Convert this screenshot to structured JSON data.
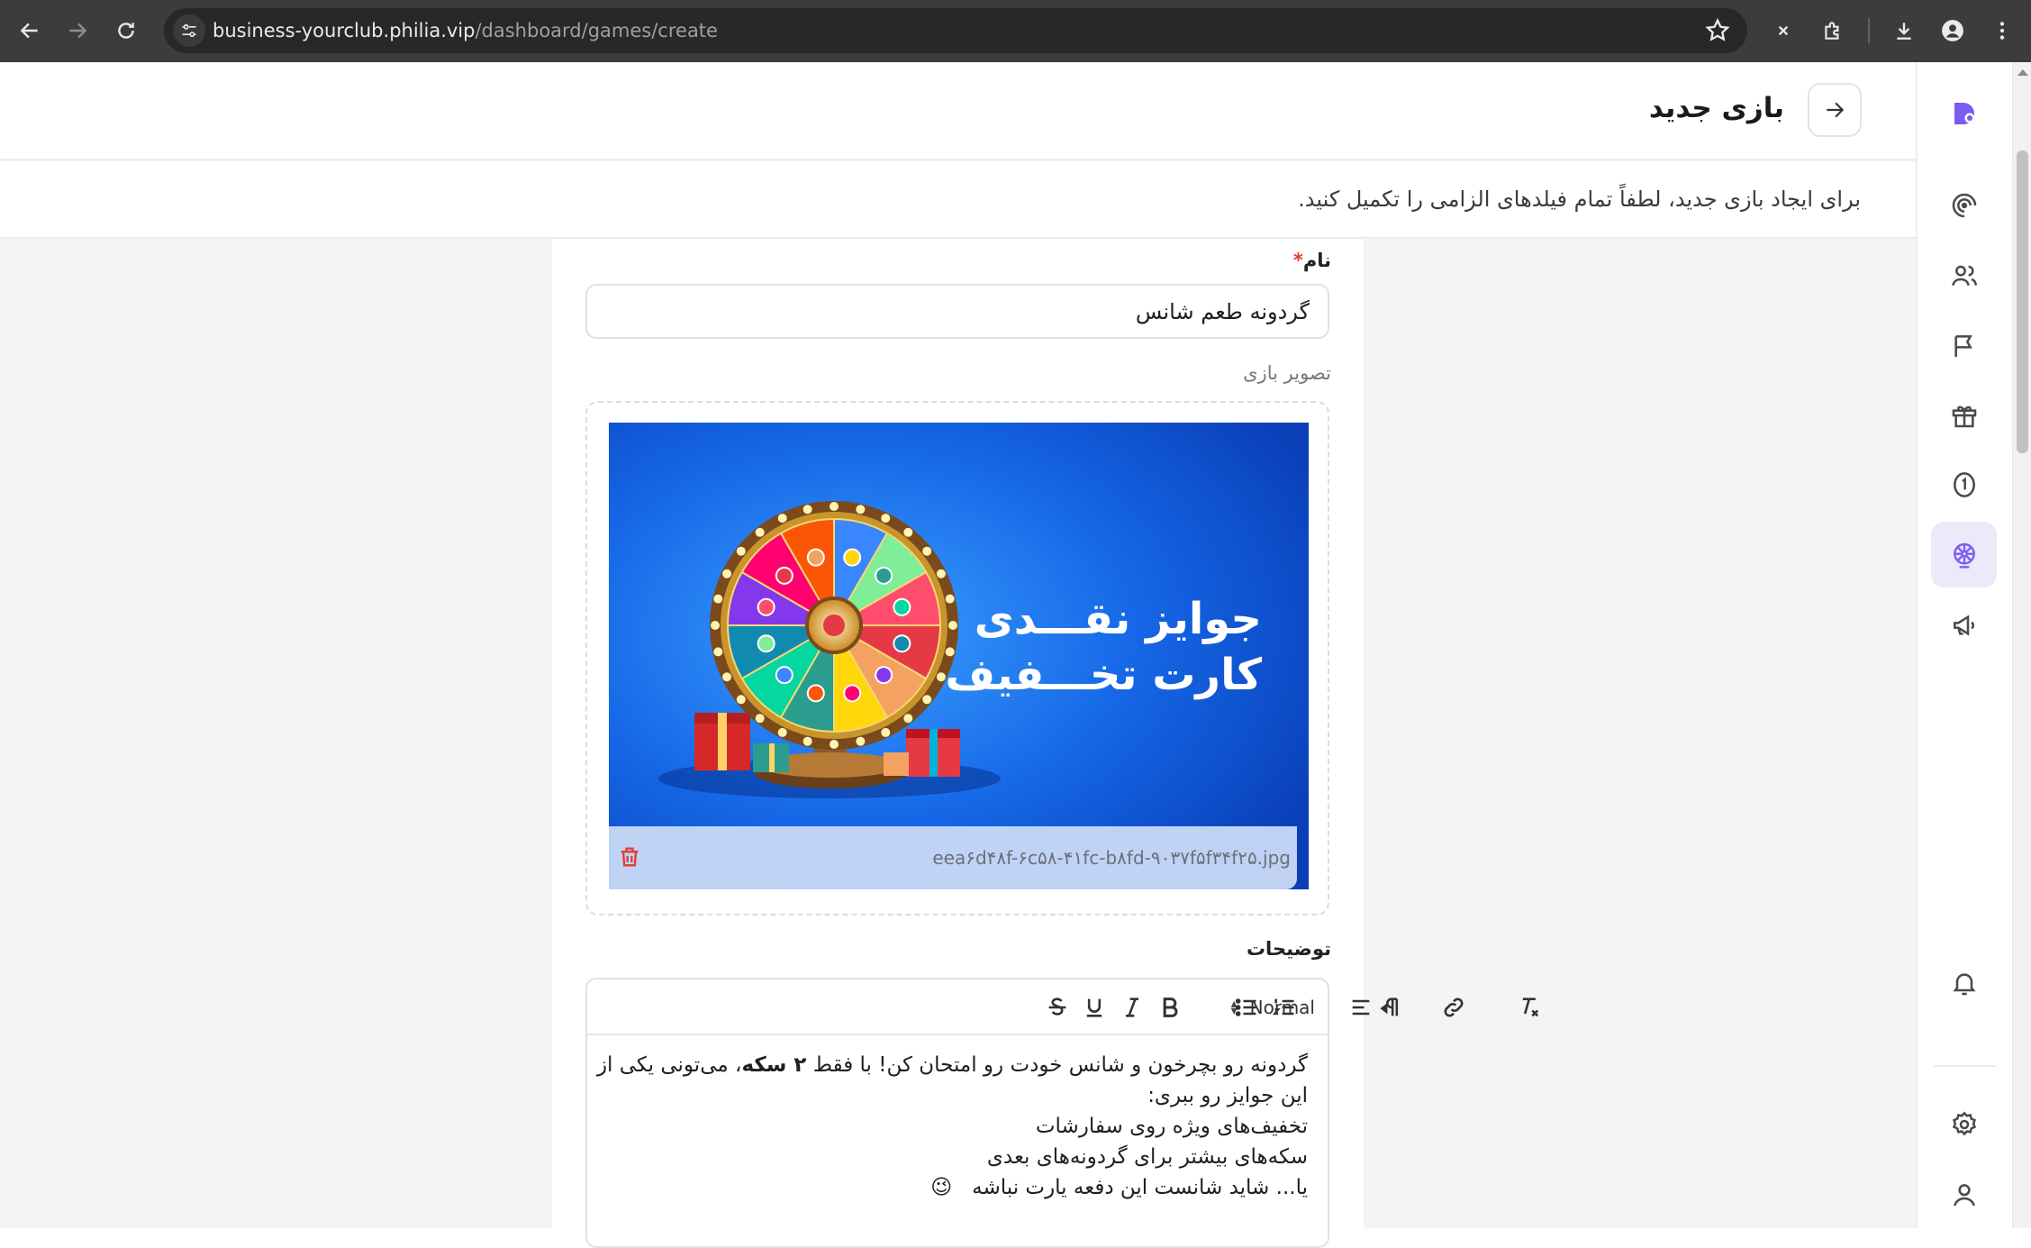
{
  "browser": {
    "url_host": "business-yourclub.philia.vip",
    "url_path": "/dashboard/games/create"
  },
  "header": {
    "title": "بازی جدید",
    "subtitle": "برای ایجاد بازی جدید، لطفاً تمام فیلدهای الزامی را تکمیل کنید."
  },
  "form": {
    "name_label": "نام",
    "required_mark": "*",
    "name_value": "گردونه طعم شانس",
    "image_label": "تصویر بازی",
    "image": {
      "headline_line1": "جوایز نقـــدی",
      "headline_line2": "کارت تخـــفیف",
      "filename": "eea۶d۴۸f-۶c۵۸-۴۱fc-b۸fd-۹۰۳۷f۵f۳۴f۲۵.jpg"
    },
    "description_label": "توضیحات",
    "editor": {
      "format_select": "Normal",
      "line1_pre": "گردونه رو بچرخون و شانس خودت رو امتحان کن! با فقط ",
      "line1_bold": "۲ سکه",
      "line1_post": "، می‌تونی یکی از این جوایز رو ببری:",
      "line2": "تخفیف‌های ویژه روی سفارشات",
      "line3": "سکه‌های بیشتر برای گردونه‌های بعدی",
      "line4": "یا... شاید شانست این دفعه یارت نباشه",
      "emoji": "😉"
    }
  },
  "colors": {
    "accent": "#7b5cf0",
    "required": "#e53935",
    "image_bg": "#0b45c4"
  },
  "sidebar": {
    "items": [
      {
        "icon": "logo-icon"
      },
      {
        "icon": "dashboard-icon"
      },
      {
        "icon": "users-icon"
      },
      {
        "icon": "flag-icon"
      },
      {
        "icon": "gift-icon"
      },
      {
        "icon": "coin-icon"
      },
      {
        "icon": "wheel-icon",
        "active": true
      },
      {
        "icon": "megaphone-icon"
      },
      {
        "icon": "bell-icon"
      },
      {
        "icon": "settings-icon"
      },
      {
        "icon": "user-icon"
      }
    ]
  }
}
